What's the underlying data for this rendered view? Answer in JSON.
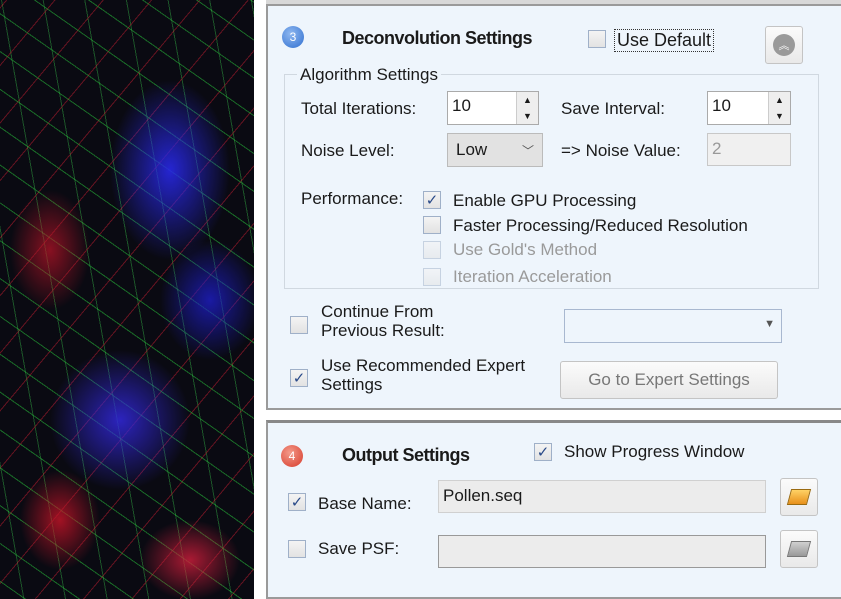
{
  "image": {
    "description_name": "microscopy-image"
  },
  "deconvolution": {
    "step": "3",
    "title": "Deconvolution Settings",
    "use_default_label": "Use Default",
    "use_default_checked": false,
    "algorithm_group": "Algorithm Settings",
    "total_iterations_label": "Total Iterations:",
    "total_iterations": "10",
    "save_interval_label": "Save Interval:",
    "save_interval": "10",
    "noise_level_label": "Noise Level:",
    "noise_level": "Low",
    "noise_value_label": "=> Noise Value:",
    "noise_value": "2",
    "performance_label": "Performance:",
    "options": [
      {
        "label": "Enable GPU Processing",
        "checked": true,
        "enabled": true
      },
      {
        "label": "Faster Processing/Reduced Resolution",
        "checked": false,
        "enabled": true
      },
      {
        "label": "Use Gold's Method",
        "checked": false,
        "enabled": false
      },
      {
        "label": "Iteration Acceleration",
        "checked": false,
        "enabled": false
      }
    ],
    "continue_label_1": "Continue From",
    "continue_label_2": "Previous Result:",
    "continue_checked": false,
    "previous_result": "",
    "expert_label_1": "Use Recommended Expert",
    "expert_label_2": "Settings",
    "expert_checked": true,
    "expert_button": "Go to Expert Settings"
  },
  "output": {
    "step": "4",
    "title": "Output Settings",
    "show_progress_label": "Show Progress Window",
    "show_progress_checked": true,
    "base_name_label": "Base Name:",
    "base_name_checked": true,
    "base_name": "Pollen.seq",
    "save_psf_label": "Save PSF:",
    "save_psf_checked": false,
    "save_psf": ""
  },
  "colors": {
    "panel_bg": "#eef5fc",
    "step3_badge": "#2f6fd0",
    "step4_badge": "#d63a2a"
  }
}
